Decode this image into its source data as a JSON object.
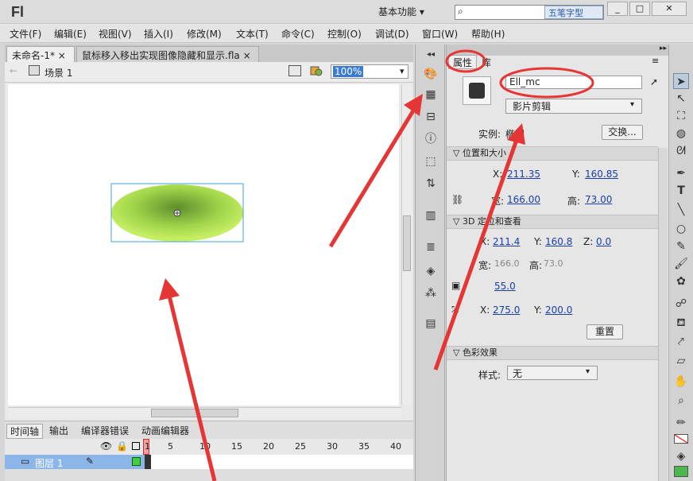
{
  "app": {
    "logo": "Fl",
    "workspace": "基本功能",
    "watermark": "五笔字型",
    "window_controls": [
      "_",
      "□",
      "✕"
    ]
  },
  "menu": [
    "文件(F)",
    "编辑(E)",
    "视图(V)",
    "插入(I)",
    "修改(M)",
    "文本(T)",
    "命令(C)",
    "控制(O)",
    "调试(D)",
    "窗口(W)",
    "帮助(H)"
  ],
  "doc_tabs": [
    "未命名-1*",
    "鼠标移入移出实现图像隐藏和显示.fla"
  ],
  "tab_close": "×",
  "scene": {
    "label": "场景 1",
    "zoom": "100%"
  },
  "timeline": {
    "tabs": [
      "时间轴",
      "输出",
      "编译器错误",
      "动画编辑器"
    ],
    "frames": [
      "1",
      "5",
      "10",
      "15",
      "20",
      "25",
      "30",
      "35",
      "40"
    ],
    "layer": "图层 1"
  },
  "props": {
    "tabs": [
      "属性",
      "库"
    ],
    "instance_name": "Ell_mc",
    "type": "影片剪辑",
    "instance_label": "实例:",
    "instance_value": "椭圆",
    "swap": "交换...",
    "section_pos": "位置和大小",
    "x_label": "X:",
    "x": "211.35",
    "y_label": "Y:",
    "y": "160.85",
    "w_label": "宽:",
    "w": "166.00",
    "h_label": "高:",
    "h": "73.00",
    "section_3d": "3D 定位和查看",
    "x3": "211.4",
    "y3": "160.8",
    "z_label": "Z:",
    "z3": "0.0",
    "w3": "166.0",
    "h3": "73.0",
    "persp": "55.0",
    "vx": "275.0",
    "vy": "200.0",
    "reset": "重置",
    "section_color": "色彩效果",
    "style_label": "样式:",
    "style": "无"
  },
  "colors": {
    "accent": "#e53535",
    "ellipse_light": "#c6ee62",
    "ellipse_dark": "#5e8e2c",
    "link": "#1a3ea8"
  }
}
